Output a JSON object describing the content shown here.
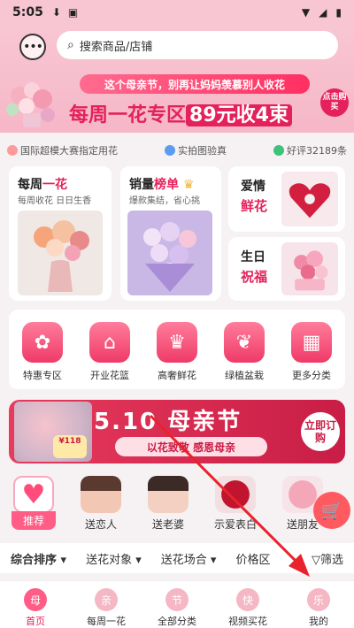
{
  "status": {
    "time": "5:05"
  },
  "search": {
    "placeholder": "搜索商品/店铺"
  },
  "banner": {
    "headline": "这个母亲节，别再让妈妈羡慕别人收花",
    "title_prefix": "每周一花专区",
    "title_price": "89元收4束",
    "cta": "点击购买"
  },
  "trust": [
    {
      "text": "国际超模大赛指定用花",
      "color": "#ff9a9a"
    },
    {
      "text": "实拍图验真",
      "color": "#5a9cf0"
    },
    {
      "text": "好评32189条",
      "color": "#3cc27a"
    }
  ],
  "cards": {
    "weekly": {
      "title_a": "每周",
      "title_b": "一花",
      "sub": "每周收花 日日生香"
    },
    "bestsell": {
      "title_a": "销量",
      "title_b": "榜单",
      "sub": "爆款集结，省心挑"
    },
    "love": {
      "line1": "爱情",
      "line2": "鲜花"
    },
    "birthday": {
      "line1": "生日",
      "line2": "祝福"
    }
  },
  "categories": [
    {
      "label": "特惠专区",
      "icon": "tag-icon",
      "glyph": "✿"
    },
    {
      "label": "开业花篮",
      "icon": "shop-icon",
      "glyph": "⌂"
    },
    {
      "label": "高奢鲜花",
      "icon": "crown-icon",
      "glyph": "♛"
    },
    {
      "label": "绿植盆栽",
      "icon": "gift-icon",
      "glyph": "❦"
    },
    {
      "label": "更多分类",
      "icon": "grid-icon",
      "glyph": "▦"
    }
  ],
  "mothers_day": {
    "title": "5.10 母亲节",
    "subtitle": "以花致敬 感恩母亲",
    "order": "立即订购",
    "price": "¥118"
  },
  "recipients": [
    {
      "label": "推荐"
    },
    {
      "label": "送恋人"
    },
    {
      "label": "送老婆"
    },
    {
      "label": "示爱表白"
    },
    {
      "label": "送朋友"
    }
  ],
  "sort": {
    "items": [
      "综合排序",
      "送花对象",
      "送花场合",
      "价格区"
    ],
    "filter": "筛选"
  },
  "nav": [
    {
      "label": "首页",
      "glyph": "母"
    },
    {
      "label": "每周一花",
      "glyph": "亲"
    },
    {
      "label": "全部分类",
      "glyph": "节"
    },
    {
      "label": "视频买花",
      "glyph": "快"
    },
    {
      "label": "我的",
      "glyph": "乐"
    }
  ]
}
